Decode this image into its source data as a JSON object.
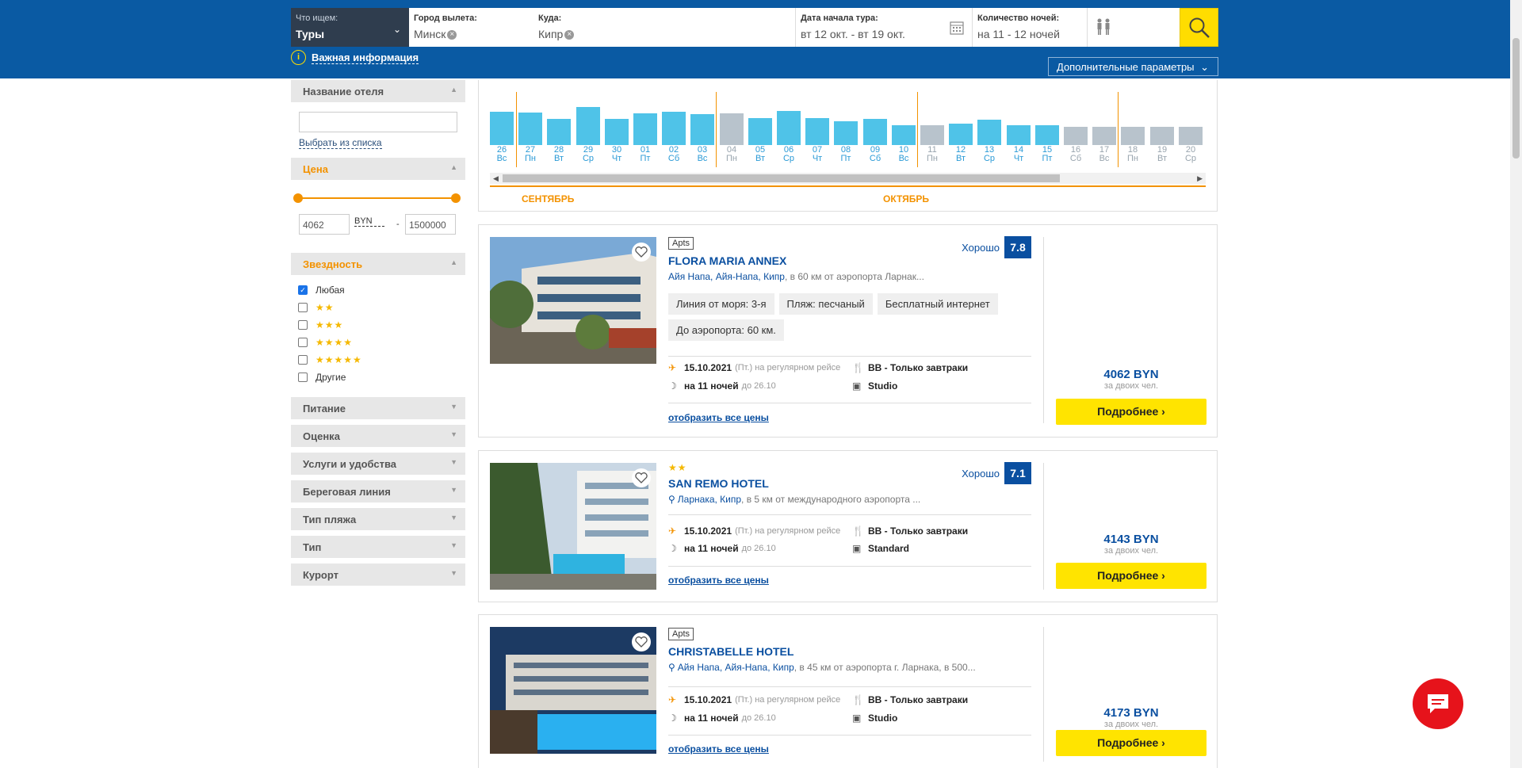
{
  "search": {
    "what_label": "Что ищем:",
    "what_value": "Туры",
    "from_label": "Город вылета:",
    "from_value": "Минск",
    "to_label": "Куда:",
    "to_value": "Кипр",
    "date_label": "Дата начала тура:",
    "date_value": "вт 12 окт. - вт 19 окт.",
    "nights_label": "Количество ночей:",
    "nights_value": "на 11 - 12 ночей"
  },
  "header": {
    "important_info": "Важная информация",
    "extra_params": "Дополнительные параметры"
  },
  "filters": {
    "hotel_name": "Название отеля",
    "choose_from_list": "Выбрать из списка",
    "price": "Цена",
    "price_min": "4062",
    "price_currency": "BYN",
    "price_dash": "-",
    "price_max": "1500000",
    "stars": "Звездность",
    "star_options": [
      {
        "label": "Любая",
        "checked": true
      },
      {
        "label": "★★",
        "checked": false
      },
      {
        "label": "★★★",
        "checked": false
      },
      {
        "label": "★★★★",
        "checked": false
      },
      {
        "label": "★★★★★",
        "checked": false
      },
      {
        "label": "Другие",
        "checked": false
      }
    ],
    "collapsed": [
      "Питание",
      "Оценка",
      "Услуги и удобства",
      "Береговая линия",
      "Тип пляжа",
      "Тип",
      "Курорт"
    ]
  },
  "calendar": {
    "days": [
      {
        "d": "26",
        "w": "Вс",
        "h": 0.68,
        "a": true
      },
      {
        "d": "27",
        "w": "Пн",
        "h": 0.66,
        "a": true
      },
      {
        "d": "28",
        "w": "Вт",
        "h": 0.54,
        "a": true
      },
      {
        "d": "29",
        "w": "Ср",
        "h": 0.78,
        "a": true
      },
      {
        "d": "30",
        "w": "Чт",
        "h": 0.53,
        "a": true
      },
      {
        "d": "01",
        "w": "Пт",
        "h": 0.65,
        "a": true
      },
      {
        "d": "02",
        "w": "Сб",
        "h": 0.68,
        "a": true
      },
      {
        "d": "03",
        "w": "Вс",
        "h": 0.63,
        "a": true
      },
      {
        "d": "04",
        "w": "Пн",
        "h": 0.64,
        "a": false
      },
      {
        "d": "05",
        "w": "Вт",
        "h": 0.55,
        "a": true
      },
      {
        "d": "06",
        "w": "Ср",
        "h": 0.7,
        "a": true
      },
      {
        "d": "07",
        "w": "Чт",
        "h": 0.55,
        "a": true
      },
      {
        "d": "08",
        "w": "Пт",
        "h": 0.48,
        "a": true
      },
      {
        "d": "09",
        "w": "Сб",
        "h": 0.54,
        "a": true
      },
      {
        "d": "10",
        "w": "Вс",
        "h": 0.4,
        "a": true
      },
      {
        "d": "11",
        "w": "Пн",
        "h": 0.4,
        "a": false
      },
      {
        "d": "12",
        "w": "Вт",
        "h": 0.43,
        "a": true
      },
      {
        "d": "13",
        "w": "Ср",
        "h": 0.51,
        "a": true
      },
      {
        "d": "14",
        "w": "Чт",
        "h": 0.4,
        "a": true
      },
      {
        "d": "15",
        "w": "Пт",
        "h": 0.4,
        "a": true
      },
      {
        "d": "16",
        "w": "Сб",
        "h": 0.37,
        "a": false
      },
      {
        "d": "17",
        "w": "Вс",
        "h": 0.37,
        "a": false
      },
      {
        "d": "18",
        "w": "Пн",
        "h": 0.37,
        "a": false
      },
      {
        "d": "19",
        "w": "Вт",
        "h": 0.37,
        "a": false
      },
      {
        "d": "20",
        "w": "Ср",
        "h": 0.37,
        "a": false
      }
    ],
    "month_sep": "СЕНТЯБРЬ",
    "month_oct": "ОКТЯБРЬ"
  },
  "hotels": [
    {
      "badge": "Apts",
      "name": "FLORA MARIA ANNEX",
      "loc_link": "Айя Напа, Айя-Напа, Кипр",
      "loc_rest": ", в 60 км от аэропорта Ларнак...",
      "rating_word": "Хорошо",
      "rating": "7.8",
      "tags": [
        "Линия от моря: 3-я",
        "Пляж: песчаный",
        "Бесплатный интернет",
        "До аэропорта: 60 км."
      ],
      "date": "15.10.2021",
      "flight": "(Пт.) на регулярном рейсе",
      "nights": "на 11 ночей",
      "until": "до 26.10",
      "board": "BB - Только завтраки",
      "room": "Studio",
      "all_prices": "отобразить все цены",
      "price": "4062 BYN",
      "for_whom": "за двоих чел.",
      "more": "Подробнее ›"
    },
    {
      "badge": "★★",
      "name": "SAN REMO HOTEL",
      "loc_link": "Ларнака, Кипр",
      "loc_rest": ", в 5 км от международного аэропорта ...",
      "rating_word": "Хорошо",
      "rating": "7.1",
      "tags": [],
      "date": "15.10.2021",
      "flight": "(Пт.) на регулярном рейсе",
      "nights": "на 11 ночей",
      "until": "до 26.10",
      "board": "BB - Только завтраки",
      "room": "Standard",
      "all_prices": "отобразить все цены",
      "price": "4143 BYN",
      "for_whom": "за двоих чел.",
      "more": "Подробнее ›"
    },
    {
      "badge": "Apts",
      "name": "CHRISTABELLE HOTEL",
      "loc_link": "Айя Напа, Айя-Напа, Кипр",
      "loc_rest": ", в 45 км от аэропорта г. Ларнака, в 500...",
      "rating_word": "",
      "rating": "",
      "tags": [],
      "date": "15.10.2021",
      "flight": "(Пт.) на регулярном рейсе",
      "nights": "на 11 ночей",
      "until": "до 26.10",
      "board": "BB - Только завтраки",
      "room": "Studio",
      "all_prices": "отобразить все цены",
      "price": "4173 BYN",
      "for_whom": "за двоих чел.",
      "more": "Подробнее ›"
    }
  ],
  "colors": {
    "header_blue": "#0a5aa3",
    "accent_orange": "#f39200",
    "button_yellow": "#ffe400",
    "bar_active": "#4fc3e8",
    "bar_inactive": "#b8c3cc"
  }
}
